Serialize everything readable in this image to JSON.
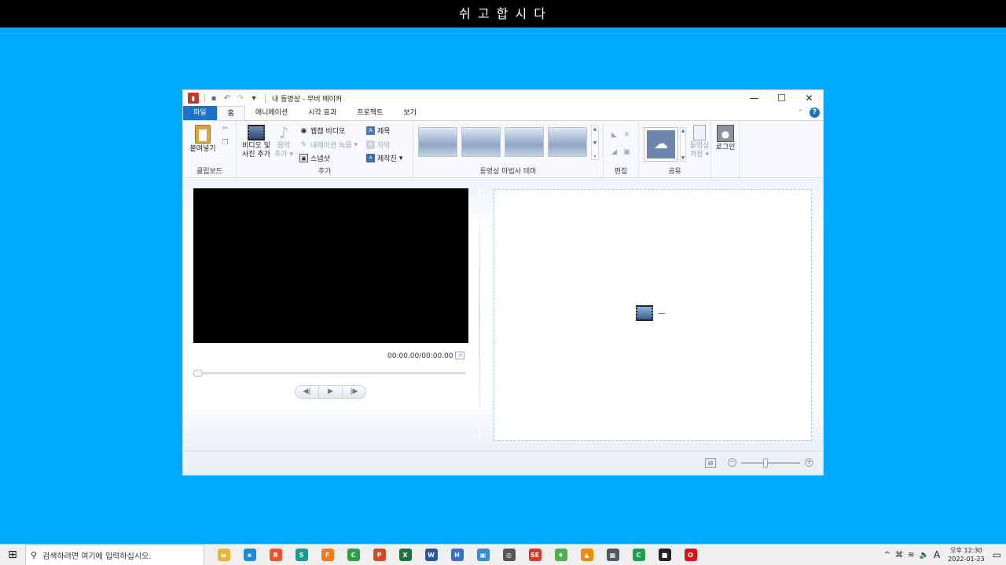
{
  "banner": {
    "text": "쉬 고 합 시 다"
  },
  "window": {
    "title": "내 동영상 - 무비 메이커",
    "controls": {
      "minimize": "—",
      "maximize": "☐",
      "close": "✕"
    }
  },
  "tabs": [
    "파일",
    "홈",
    "애니메이션",
    "시각 효과",
    "프로젝트",
    "보기"
  ],
  "ribbon": {
    "clipboard": {
      "paste": "붙여넣기",
      "label": "클립보드"
    },
    "add": {
      "add_video_line1": "비디오 및",
      "add_video_line2": "사진 추가",
      "add_music_line1": "음악",
      "add_music_line2": "추가",
      "webcam": "웹캠 비디오",
      "narration": "내레이션 녹음",
      "snapshot": "스냅샷",
      "title": "제목",
      "caption": "자막",
      "credits": "제작진",
      "label": "추가"
    },
    "themes": {
      "label": "동영상 마법사 테마"
    },
    "edit": {
      "label": "편집"
    },
    "share": {
      "save_line1": "동영상",
      "save_line2": "저장",
      "label": "공유"
    },
    "signin": {
      "label": "로그인"
    }
  },
  "player": {
    "timecode": "00:00.00/00:00.00",
    "prev": "◀|",
    "play": "▶",
    "next": "|▶"
  },
  "storyboard": {
    "placeholder": "—"
  },
  "taskbar": {
    "search_placeholder": "검색하려면 여기에 입력하십시오.",
    "apps": [
      {
        "name": "file-explorer",
        "glyph": "▬",
        "color": "#e8b43a"
      },
      {
        "name": "edge",
        "glyph": "e",
        "color": "#1f8ad6"
      },
      {
        "name": "brave",
        "glyph": "B",
        "color": "#f0522d"
      },
      {
        "name": "app-teal",
        "glyph": "S",
        "color": "#179c8c"
      },
      {
        "name": "firefox",
        "glyph": "F",
        "color": "#ef7b1a"
      },
      {
        "name": "chrome",
        "glyph": "C",
        "color": "#2f9e44"
      },
      {
        "name": "powerpoint",
        "glyph": "P",
        "color": "#d24726"
      },
      {
        "name": "excel",
        "glyph": "X",
        "color": "#1e7145"
      },
      {
        "name": "word",
        "glyph": "W",
        "color": "#2b579a"
      },
      {
        "name": "hwp",
        "glyph": "H",
        "color": "#3b6fc4"
      },
      {
        "name": "remote-desktop",
        "glyph": "▣",
        "color": "#3a8ad0"
      },
      {
        "name": "magnifier",
        "glyph": "◎",
        "color": "#555555"
      },
      {
        "name": "se-app",
        "glyph": "SE",
        "color": "#d9352b"
      },
      {
        "name": "app-green",
        "glyph": "♦",
        "color": "#4caf50"
      },
      {
        "name": "vlc",
        "glyph": "▲",
        "color": "#f08a00"
      },
      {
        "name": "calculator",
        "glyph": "▦",
        "color": "#505a66"
      },
      {
        "name": "chrome-2",
        "glyph": "C",
        "color": "#1a9e50"
      },
      {
        "name": "sticky-notes",
        "glyph": "■",
        "color": "#222222"
      },
      {
        "name": "opera",
        "glyph": "O",
        "color": "#e0101b"
      }
    ],
    "tray": {
      "chevron": "^",
      "ime": "A",
      "time_line1": "오후 12:30",
      "time_line2": "2022-01-23"
    }
  }
}
